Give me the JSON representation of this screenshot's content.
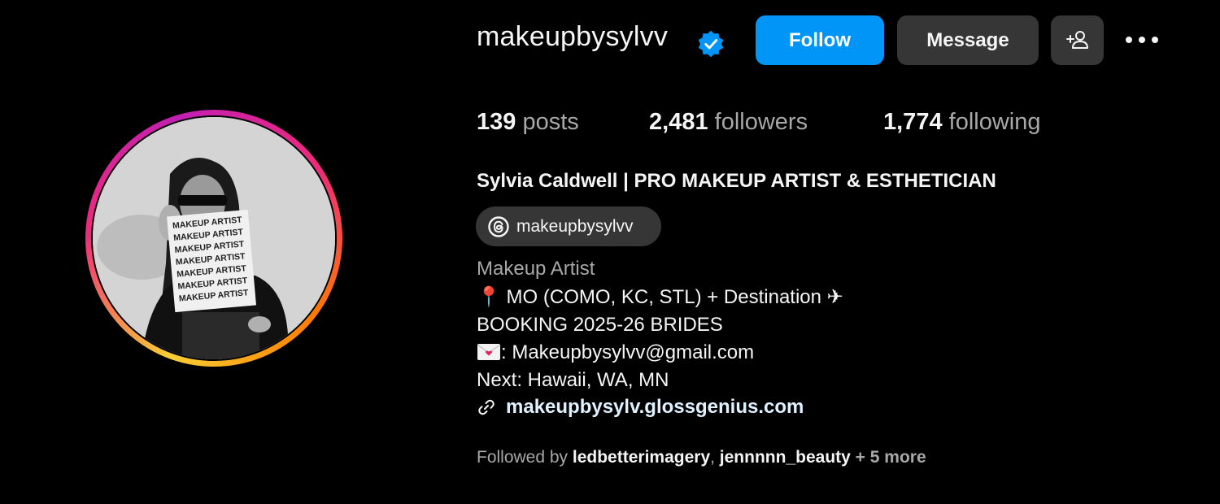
{
  "profile": {
    "username": "makeupbysylvv",
    "verified": true,
    "full_name": "Sylvia Caldwell | PRO MAKEUP ARTIST & ESTHETICIAN",
    "threads_handle": "makeupbysylvv"
  },
  "actions": {
    "follow_label": "Follow",
    "message_label": "Message"
  },
  "stats": {
    "posts_count": "139",
    "posts_label": "posts",
    "followers_count": "2,481",
    "followers_label": "followers",
    "following_count": "1,774",
    "following_label": "following"
  },
  "bio": {
    "category": "Makeup Artist",
    "line1_emoji": "📍",
    "line1_text": " MO (COMO, KC, STL) + Destination ✈",
    "line2": "BOOKING 2025-26 BRIDES",
    "line3_text": ": Makeupbysylvv@gmail.com",
    "line4": "Next: Hawaii, WA, MN",
    "link": "makeupbysylv.glossgenius.com"
  },
  "followed_by": {
    "prefix": "Followed by ",
    "name1": "ledbetterimagery",
    "separator": ", ",
    "name2": "jennnnn_beauty",
    "more": " + 5 more"
  },
  "avatar": {
    "sign_lines": [
      "MAKEUP ARTIST",
      "MAKEUP ARTIST",
      "MAKEUP ARTIST",
      "MAKEUP ARTIST",
      "MAKEUP ARTIST",
      "MAKEUP ARTIST",
      "MAKEUP ARTIST"
    ]
  },
  "colors": {
    "background": "#000000",
    "follow_button": "#0095f6",
    "secondary_button": "#363636",
    "muted_text": "#a8a8a8",
    "verified_badge": "#0095f6",
    "link_text": "#e0f1ff"
  },
  "icons": {
    "verified": "verified-badge-icon",
    "add_user": "add-user-icon",
    "more": "more-options-icon",
    "threads": "threads-icon",
    "pin": "location-pin-icon",
    "mail": "love-letter-icon",
    "link": "link-icon"
  }
}
